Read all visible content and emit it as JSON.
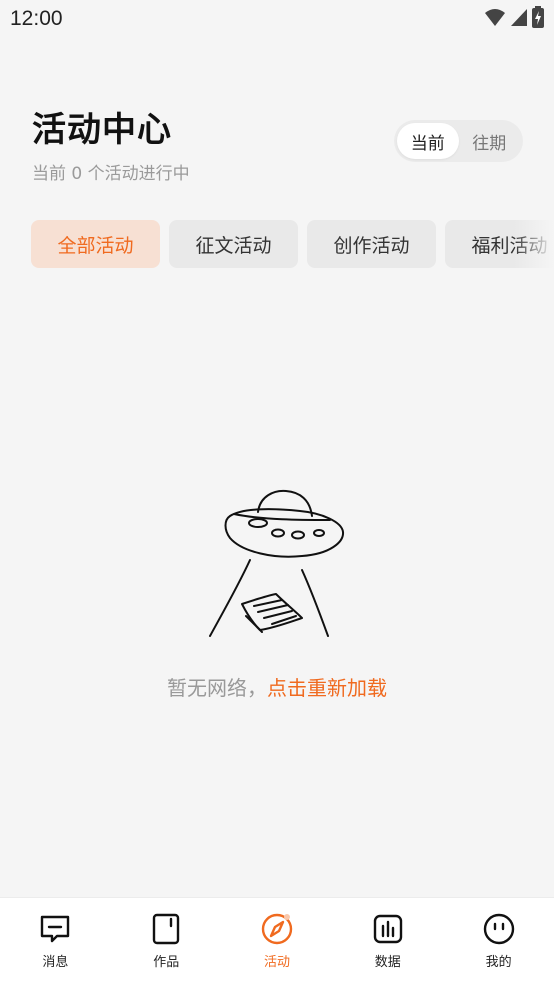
{
  "status_bar": {
    "time": "12:00"
  },
  "header": {
    "title": "活动中心",
    "subtitle": "当前 0 个活动进行中",
    "toggle": [
      {
        "label": "当前",
        "active": true
      },
      {
        "label": "往期",
        "active": false
      }
    ]
  },
  "filters": [
    {
      "label": "全部活动",
      "active": true
    },
    {
      "label": "征文活动",
      "active": false
    },
    {
      "label": "创作活动",
      "active": false
    },
    {
      "label": "福利活动",
      "active": false
    }
  ],
  "empty_state": {
    "message": "暂无网络，",
    "reload_label": "点击重新加载"
  },
  "bottom_nav": [
    {
      "label": "消息",
      "icon": "message-icon",
      "active": false
    },
    {
      "label": "作品",
      "icon": "book-icon",
      "active": false
    },
    {
      "label": "活动",
      "icon": "compass-icon",
      "active": true
    },
    {
      "label": "数据",
      "icon": "chart-icon",
      "active": false
    },
    {
      "label": "我的",
      "icon": "face-icon",
      "active": false
    }
  ],
  "colors": {
    "accent": "#f06a1f",
    "chip_active_bg": "#f7e0d3",
    "background": "#f5f5f5"
  }
}
